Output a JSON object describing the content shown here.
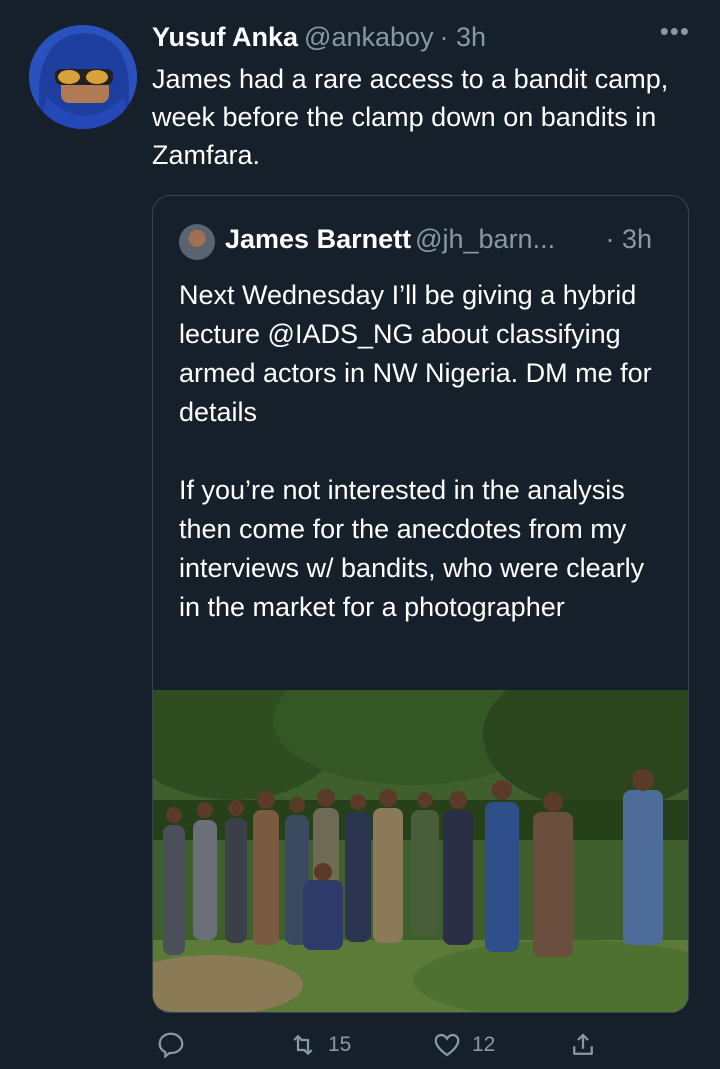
{
  "tweet": {
    "author_name": "Yusuf Anka",
    "author_handle": "@ankaboy",
    "time": "· 3h",
    "text": "James had a rare access to a bandit camp, week before the clamp down on bandits in Zamfara.",
    "more_icon": "ellipsis-icon"
  },
  "quoted_tweet": {
    "author_name": "James Barnett",
    "author_handle": "@jh_barn...",
    "time": "· 3h",
    "text": "Next Wednesday I’ll be giving a hybrid lecture @IADS_NG about classifying armed actors in NW Nigeria. DM me for details\n\nIf you’re not interested in the analysis then come for the anecdotes from my interviews w/ bandits, who were clearly in the market for a photographer"
  },
  "actions": {
    "reply_icon": "reply-icon",
    "retweet_count": "15",
    "like_count": "12",
    "share_icon": "share-icon"
  },
  "colors": {
    "background": "#15202b",
    "secondary_text": "#8899a6",
    "border": "#38444d"
  }
}
